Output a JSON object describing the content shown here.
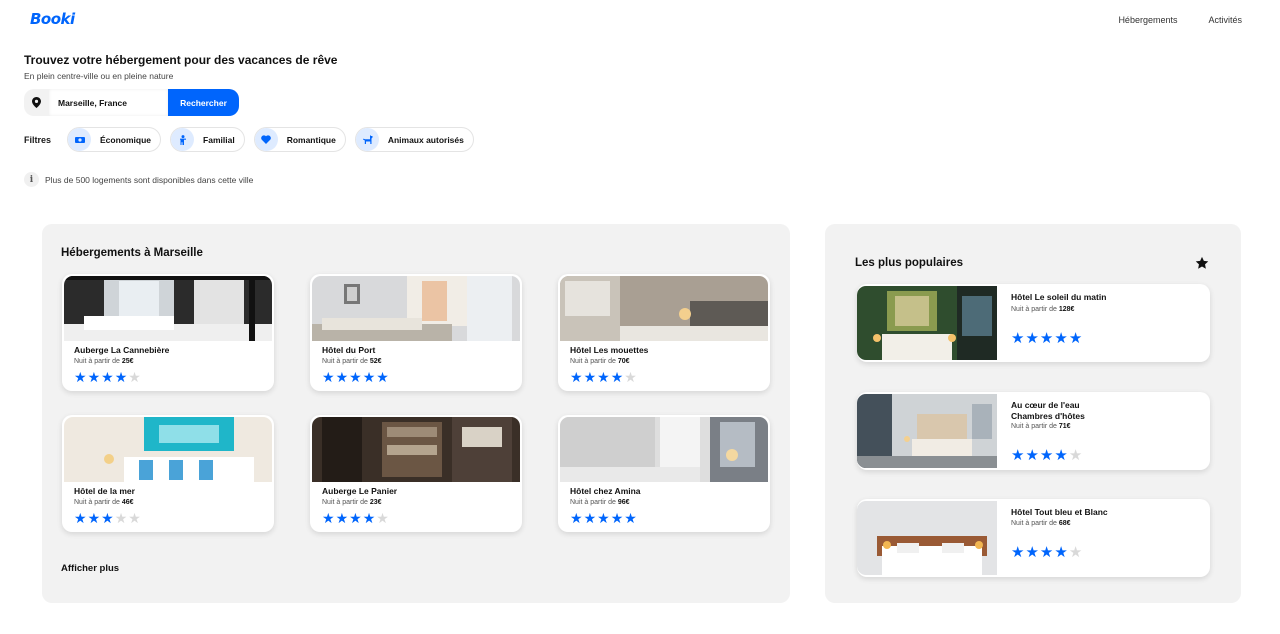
{
  "header": {
    "logo": "Booki",
    "nav": [
      "Hébergements",
      "Activités"
    ]
  },
  "hero": {
    "title": "Trouvez votre hébergement pour des vacances de rêve",
    "subtitle": "En plein centre-ville ou en pleine nature"
  },
  "search": {
    "value": "Marseille, France",
    "button_label": "Rechercher"
  },
  "filters": {
    "label": "Filtres",
    "items": [
      "Économique",
      "Familial",
      "Romantique",
      "Animaux autorisés"
    ]
  },
  "info": {
    "icon": "i",
    "text": "Plus de 500 logements sont disponibles dans cette ville"
  },
  "listings": {
    "title": "Hébergements à Marseille",
    "more_label": "Afficher plus",
    "price_prefix": "Nuit à partir de",
    "items": [
      {
        "name": "Auberge La Cannebière",
        "price": "25€",
        "rating": 4
      },
      {
        "name": "Hôtel du Port",
        "price": "52€",
        "rating": 5
      },
      {
        "name": "Hôtel Les mouettes",
        "price": "70€",
        "rating": 4
      },
      {
        "name": "Hôtel de la mer",
        "price": "46€",
        "rating": 3
      },
      {
        "name": "Auberge Le Panier",
        "price": "23€",
        "rating": 4
      },
      {
        "name": "Hôtel chez Amina",
        "price": "96€",
        "rating": 5
      }
    ]
  },
  "popular": {
    "title": "Les plus populaires",
    "items": [
      {
        "name": "Hôtel Le soleil du matin",
        "price": "128€",
        "rating": 5
      },
      {
        "name": "Au cœur de l'eau Chambres d'hôtes",
        "price": "71€",
        "rating": 4
      },
      {
        "name": "Hôtel Tout bleu et Blanc",
        "price": "68€",
        "rating": 4
      }
    ]
  },
  "colors": {
    "accent": "#0065fc",
    "panel": "#f2f2f2",
    "chip_bg": "#deebff"
  }
}
